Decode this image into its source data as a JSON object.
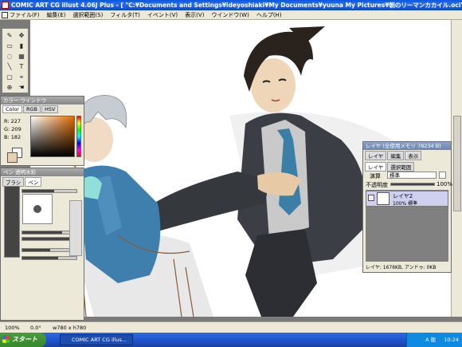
{
  "window": {
    "title": "COMIC ART CG illust 4.06J Plus - [ \"C:¥Documents and Settings¥ideyoshiaki¥My Documents¥yuuna My Pictures¥朝のリーマンカカイル.oci\" ]"
  },
  "menu": [
    "ファイル(F)",
    "編集(E)",
    "選択範囲(S)",
    "フィルタ(T)",
    "イベント(V)",
    "表示(V)",
    "ウインドウ(W)",
    "ヘルプ(H)"
  ],
  "color_panel": {
    "title": "カラー ウインドウ",
    "tabs": [
      "Color",
      "RGB",
      "HSV"
    ],
    "r": "R: 227",
    "g": "G: 209",
    "b": "B: 182",
    "fg_color": "#e3d1b6",
    "bg_color": "#ffffff"
  },
  "pen_panel": {
    "title": "ペン 透明水彩",
    "tabs": [
      "ブラシ",
      "ペン"
    ]
  },
  "layer_panel": {
    "title": "レイヤ (全使用メモリ 78234 B)",
    "tabs_row1": [
      "レイヤ",
      "編集",
      "表示"
    ],
    "tabs_row2": [
      "レイヤ",
      "選択範囲"
    ],
    "mode_label": "演算",
    "mode_value": "標準",
    "opacity_label": "不透明度",
    "opacity_value": "100%",
    "opacity": 1.0,
    "layer_name": "レイヤ2",
    "layer_info": "100% 標準",
    "footer": "レイヤ: 1676KB, アンドゥ: 0KB"
  },
  "status": {
    "zoom": "100%",
    "angle": "0.0°",
    "size": "w780 x h780"
  },
  "taskbar": {
    "start": "スタート",
    "task": "COMIC ART CG illus...",
    "tray_lang": "A 般",
    "clock": "10:24"
  }
}
